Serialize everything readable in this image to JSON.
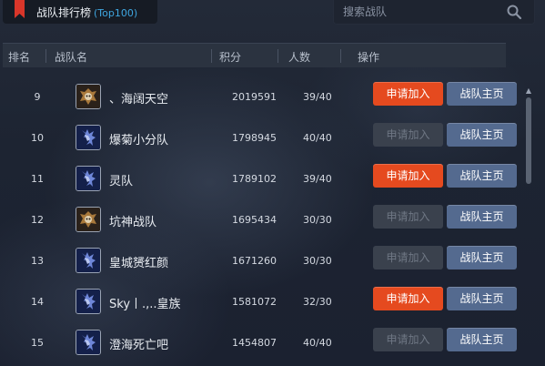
{
  "title": {
    "main": "战队排行榜",
    "sub": "(Top100)"
  },
  "search": {
    "placeholder": "搜索战队"
  },
  "columns": {
    "rank": "排名",
    "team": "战队名",
    "score": "积分",
    "count": "人数",
    "action": "操作"
  },
  "buttons": {
    "apply": "申请加入",
    "home": "战队主页"
  },
  "colors": {
    "apply_active": "#e54a1f",
    "apply_disabled": "#3a414d",
    "home": "#546a8f",
    "accent_blue": "#3ea6e0",
    "bookmark": "#d9362a"
  },
  "rows": [
    {
      "rank": "9",
      "name": "、海阔天空",
      "score": "2019591",
      "members": "39/40",
      "apply_enabled": true,
      "emblem": "gold-skull-emblem-icon"
    },
    {
      "rank": "10",
      "name": "爆菊小分队",
      "score": "1798945",
      "members": "40/40",
      "apply_enabled": false,
      "emblem": "blue-dragon-emblem-icon"
    },
    {
      "rank": "11",
      "name": "灵队",
      "score": "1789102",
      "members": "39/40",
      "apply_enabled": true,
      "emblem": "blue-dragon-emblem-icon"
    },
    {
      "rank": "12",
      "name": "坑神战队",
      "score": "1695434",
      "members": "30/30",
      "apply_enabled": false,
      "emblem": "gold-skull-emblem-icon"
    },
    {
      "rank": "13",
      "name": "皇城赟红颜",
      "score": "1671260",
      "members": "30/30",
      "apply_enabled": false,
      "emblem": "blue-dragon-emblem-icon"
    },
    {
      "rank": "14",
      "name": "Sky丨.,..皇族",
      "score": "1581072",
      "members": "32/30",
      "apply_enabled": true,
      "emblem": "blue-dragon-emblem-icon"
    },
    {
      "rank": "15",
      "name": "澄海死亡吧",
      "score": "1454807",
      "members": "40/40",
      "apply_enabled": false,
      "emblem": "blue-dragon-emblem-icon"
    }
  ]
}
